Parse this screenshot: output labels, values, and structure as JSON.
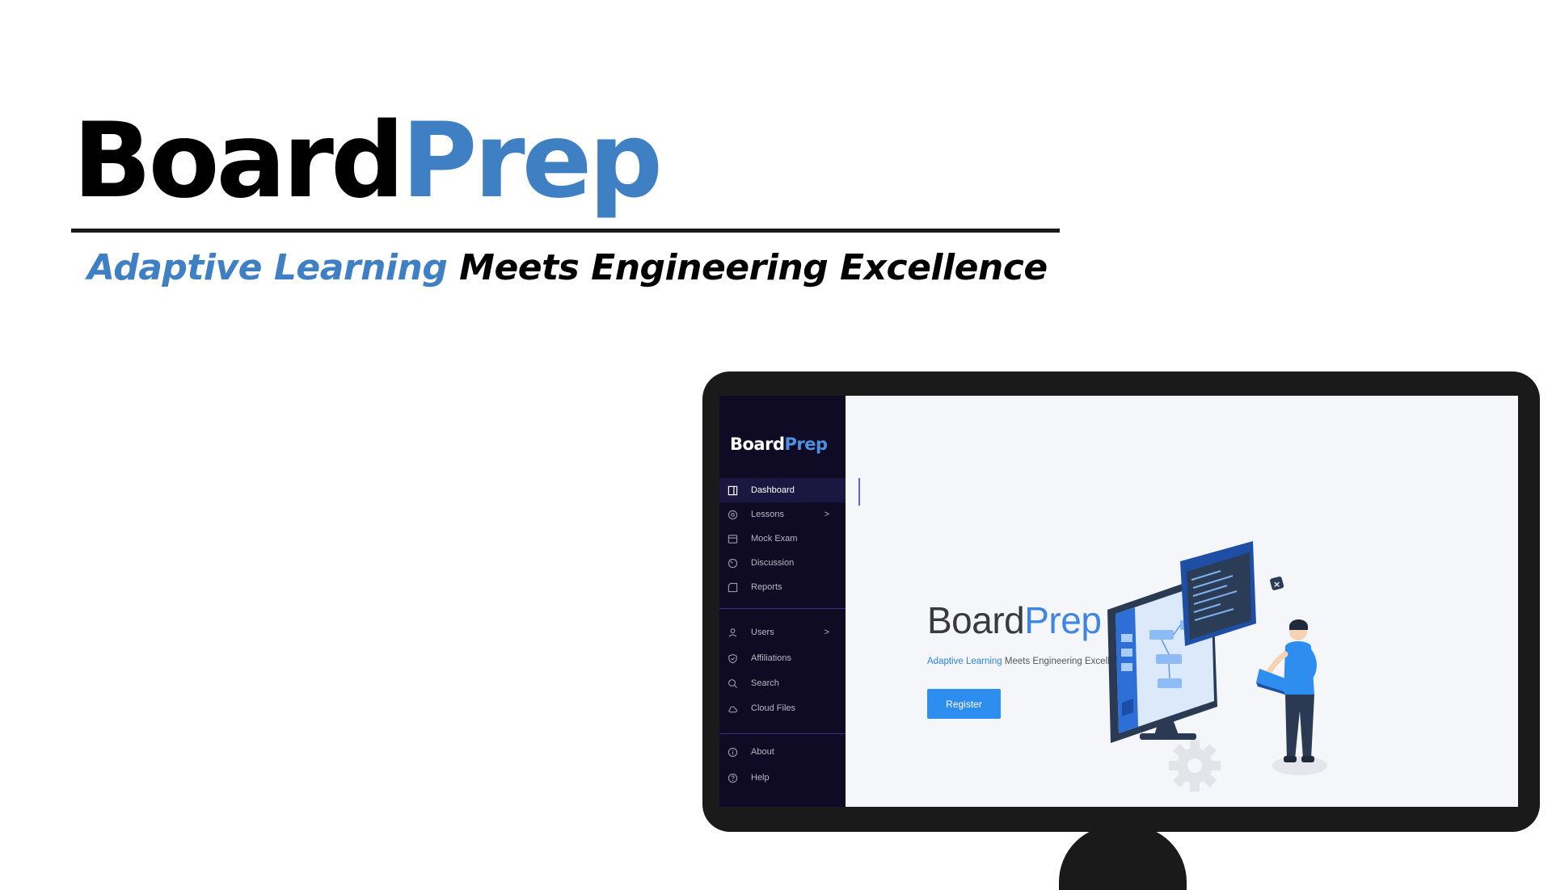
{
  "brand": {
    "part1": "Board",
    "part2": "Prep"
  },
  "tagline": {
    "accent": "Adaptive Learning",
    "rest": " Meets Engineering Excellence"
  },
  "sidebar": {
    "logo": {
      "part1": "Board",
      "part2": "Prep"
    },
    "items": [
      {
        "label": "Dashboard",
        "icon": "dashboard-icon",
        "active": true
      },
      {
        "label": "Lessons",
        "icon": "lessons-icon",
        "chevron": ">"
      },
      {
        "label": "Mock Exam",
        "icon": "mock-exam-icon"
      },
      {
        "label": "Discussion",
        "icon": "discussion-icon"
      },
      {
        "label": "Reports",
        "icon": "reports-icon"
      },
      {
        "label": "Users",
        "icon": "user-icon",
        "chevron": ">"
      },
      {
        "label": "Affiliations",
        "icon": "shield-icon"
      },
      {
        "label": "Search",
        "icon": "search-icon"
      },
      {
        "label": "Cloud Files",
        "icon": "cloud-icon"
      },
      {
        "label": "About",
        "icon": "info-icon"
      },
      {
        "label": "Help",
        "icon": "help-icon"
      }
    ]
  },
  "main": {
    "title": {
      "part1": "Board",
      "part2": "Prep"
    },
    "subtitle": {
      "accent": "Adaptive Learning",
      "rest": " Meets Engineering Excellence"
    },
    "register_label": "Register"
  },
  "colors": {
    "accent": "#3f7fc4",
    "sidebar_bg": "#100b24",
    "button": "#2d8ef0",
    "monitor": "#1a1a1a"
  }
}
